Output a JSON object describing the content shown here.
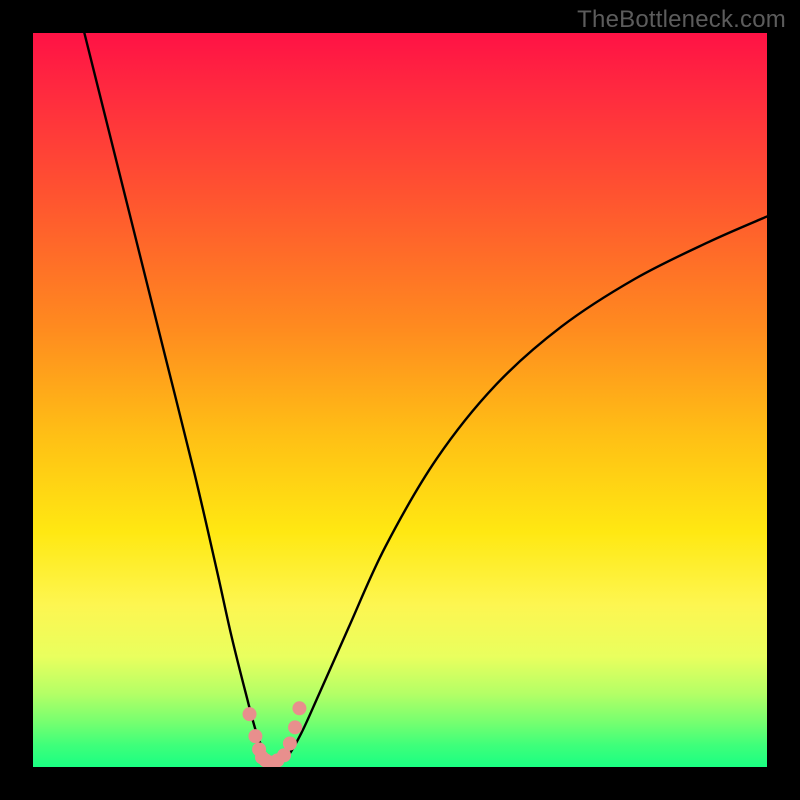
{
  "watermark": "TheBottleneck.com",
  "chart_data": {
    "type": "line",
    "title": "",
    "xlabel": "",
    "ylabel": "",
    "xlim": [
      0,
      100
    ],
    "ylim": [
      0,
      100
    ],
    "gradient_bands": [
      {
        "name": "red",
        "approx_y_range": [
          70,
          100
        ]
      },
      {
        "name": "orange",
        "approx_y_range": [
          40,
          70
        ]
      },
      {
        "name": "yellow",
        "approx_y_range": [
          12,
          40
        ]
      },
      {
        "name": "green",
        "approx_y_range": [
          0,
          12
        ]
      }
    ],
    "series": [
      {
        "name": "bottleneck-curve",
        "color": "#000000",
        "x": [
          7,
          10,
          14,
          18,
          22,
          25,
          27,
          29,
          30.5,
          32,
          33,
          34.5,
          36.5,
          39,
          43,
          48,
          55,
          63,
          72,
          82,
          92,
          100
        ],
        "y": [
          100,
          88,
          72,
          56,
          40,
          27,
          18,
          10,
          4.5,
          1.2,
          0.5,
          1.2,
          4.5,
          10,
          19,
          30,
          42,
          52,
          60,
          66.5,
          71.5,
          75
        ]
      },
      {
        "name": "highlight-valley",
        "color": "#e88f8d",
        "x": [
          29.5,
          30.3,
          30.8,
          31.2,
          31.7,
          32.5,
          33.3,
          34.2,
          35.0,
          35.7,
          36.3
        ],
        "y": [
          7.2,
          4.2,
          2.4,
          1.3,
          0.9,
          0.6,
          0.9,
          1.6,
          3.2,
          5.4,
          8.0
        ]
      }
    ],
    "minimum": {
      "x": 33,
      "y": 0.5
    }
  }
}
